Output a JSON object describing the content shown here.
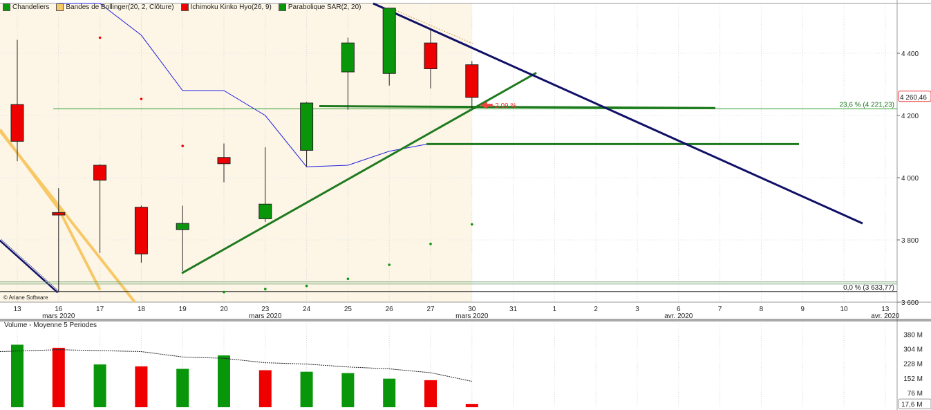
{
  "legend": [
    {
      "label": "Chandeliers",
      "color": "#1a8a1a"
    },
    {
      "label": "Bandes de Bollinger(20, 2, Clôture)",
      "color": "#f8c867"
    },
    {
      "label": "Ichimoku Kinko Hyo(26, 9)",
      "color": "#e01010"
    },
    {
      "label": "Parabolique SAR(2, 20)",
      "color": "#1a8a1a"
    }
  ],
  "copyright": "© Ariane Software",
  "volume_title": "Volume  - Moyenne 5 Periodes",
  "price_badge": "4 260,46",
  "fib_236_label": "23,6 % (4 221,23)",
  "fib_0_label": "0,0 % (3 633,77)",
  "pct_label": "-2,09 %",
  "colors": {
    "up": "#0a960a",
    "down": "#ee0000",
    "trend": "#1f7a1f",
    "resistance": "#101068",
    "kijun": "#2020e0",
    "bollinger": "#f8c867"
  },
  "chart_data": [
    {
      "type": "candlestick",
      "title": "",
      "price_axis": {
        "ylim": [
          3600,
          4560
        ],
        "ticks": [
          "3 600",
          "3 800",
          "4 000",
          "4 200",
          "4 400"
        ],
        "tick_values": [
          3600,
          3800,
          4000,
          4200,
          4400
        ]
      },
      "x_ticks": [
        {
          "label": "13",
          "sub": ""
        },
        {
          "label": "16",
          "sub": "mars 2020"
        },
        {
          "label": "17",
          "sub": ""
        },
        {
          "label": "18",
          "sub": ""
        },
        {
          "label": "19",
          "sub": ""
        },
        {
          "label": "20",
          "sub": ""
        },
        {
          "label": "23",
          "sub": "mars 2020"
        },
        {
          "label": "24",
          "sub": ""
        },
        {
          "label": "25",
          "sub": ""
        },
        {
          "label": "26",
          "sub": ""
        },
        {
          "label": "27",
          "sub": ""
        },
        {
          "label": "30",
          "sub": "mars 2020"
        },
        {
          "label": "31",
          "sub": ""
        },
        {
          "label": "1",
          "sub": ""
        },
        {
          "label": "2",
          "sub": ""
        },
        {
          "label": "3",
          "sub": ""
        },
        {
          "label": "6",
          "sub": "avr. 2020"
        },
        {
          "label": "7",
          "sub": ""
        },
        {
          "label": "8",
          "sub": ""
        },
        {
          "label": "9",
          "sub": ""
        },
        {
          "label": "10",
          "sub": ""
        },
        {
          "label": "13",
          "sub": "avr. 2020"
        }
      ],
      "candles": [
        {
          "date": "13",
          "open": 4235,
          "high": 4443,
          "low": 4053,
          "close": 4117
        },
        {
          "date": "16",
          "open": 3888,
          "high": 3966,
          "low": 3632,
          "close": 3880
        },
        {
          "date": "17",
          "open": 4040,
          "high": 4043,
          "low": 3758,
          "close": 3992
        },
        {
          "date": "18",
          "open": 3905,
          "high": 3910,
          "low": 3727,
          "close": 3755
        },
        {
          "date": "19",
          "open": 3833,
          "high": 3910,
          "low": 3700,
          "close": 3853
        },
        {
          "date": "20",
          "open": 4065,
          "high": 4110,
          "low": 3985,
          "close": 4045
        },
        {
          "date": "23",
          "open": 3868,
          "high": 4098,
          "low": 3858,
          "close": 3915
        },
        {
          "date": "24",
          "open": 4088,
          "high": 4243,
          "low": 4036,
          "close": 4240
        },
        {
          "date": "25",
          "open": 4340,
          "high": 4450,
          "low": 4218,
          "close": 4433
        },
        {
          "date": "26",
          "open": 4335,
          "high": 4540,
          "low": 4296,
          "close": 4545
        },
        {
          "date": "27",
          "open": 4433,
          "high": 4475,
          "low": 4287,
          "close": 4350
        },
        {
          "date": "30",
          "open": 4363,
          "high": 4375,
          "low": 4221,
          "close": 4258
        }
      ],
      "parabolic_sar": [
        {
          "date": "17",
          "value": 4450
        },
        {
          "date": "18",
          "value": 4253
        },
        {
          "date": "19",
          "value": 4102
        },
        {
          "date": "20",
          "value": 3632
        },
        {
          "date": "23",
          "value": 3642
        },
        {
          "date": "24",
          "value": 3652
        },
        {
          "date": "25",
          "value": 3675
        },
        {
          "date": "26",
          "value": 3720
        },
        {
          "date": "27",
          "value": 3787
        },
        {
          "date": "30",
          "value": 3850
        }
      ],
      "kijun": [
        {
          "date": "16",
          "value": 4560
        },
        {
          "date": "17",
          "value": 4560
        },
        {
          "date": "18",
          "value": 4458
        },
        {
          "date": "19",
          "value": 4280
        },
        {
          "date": "20",
          "value": 4280
        },
        {
          "date": "23",
          "value": 4200
        },
        {
          "date": "24",
          "value": 4035
        },
        {
          "date": "25",
          "value": 4040
        },
        {
          "date": "26",
          "value": 4085
        },
        {
          "date": "27",
          "value": 4110
        },
        {
          "date": "30",
          "value": 4110
        }
      ],
      "fibonacci": [
        {
          "level": "23,6 %",
          "value": 4221.23
        },
        {
          "level": "0,0 %",
          "value": 3633.77
        }
      ],
      "last_price": 4260.46
    },
    {
      "type": "bar",
      "title": "Volume",
      "ylim": [
        0,
        400
      ],
      "unit": "M",
      "ticks": [
        "76 M",
        "152 M",
        "228 M",
        "304 M",
        "380 M"
      ],
      "tick_values": [
        76,
        152,
        228,
        304,
        380
      ],
      "last_volume": "17,6 M",
      "categories": [
        "13",
        "16",
        "17",
        "18",
        "19",
        "20",
        "23",
        "24",
        "25",
        "26",
        "27",
        "30"
      ],
      "values": [
        326,
        310,
        223,
        213,
        200,
        270,
        193,
        185,
        178,
        149,
        141,
        17.6
      ],
      "colors": [
        "up",
        "down",
        "up",
        "down",
        "up",
        "up",
        "down",
        "up",
        "up",
        "up",
        "down",
        "down"
      ],
      "moving_average_5": [
        290,
        300,
        295,
        290,
        262,
        255,
        232,
        225,
        210,
        200,
        180,
        135
      ]
    }
  ]
}
